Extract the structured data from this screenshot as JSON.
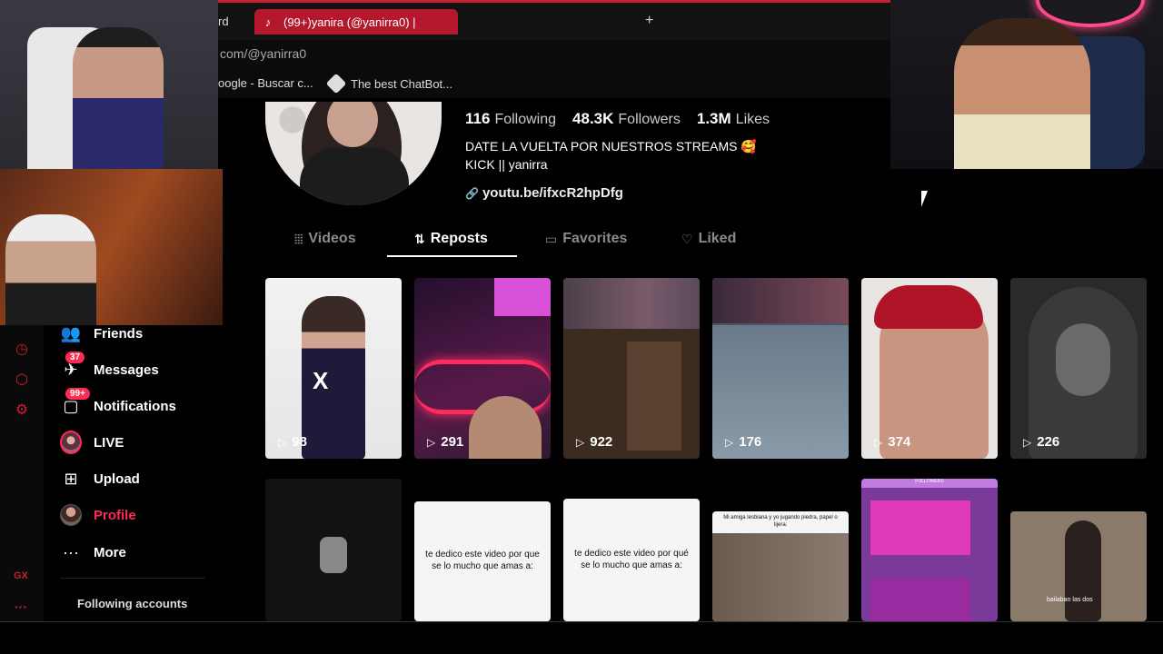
{
  "browser": {
    "prev_tab_fragment": "rd",
    "active_tab": "(99+)yanira (@yanirra0) |",
    "new_tab": "+",
    "url": "com/@yanirra0",
    "bookmarks": [
      "oogle - Buscar c...",
      "The best ChatBot..."
    ]
  },
  "profile": {
    "stats": [
      {
        "value": "116",
        "label": "Following"
      },
      {
        "value": "48.3K",
        "label": "Followers"
      },
      {
        "value": "1.3M",
        "label": "Likes"
      }
    ],
    "bio_line1": "DATE LA VUELTA POR NUESTROS STREAMS 🥰",
    "bio_line2": "KICK || yanirra",
    "link": "youtu.be/ifxcR2hpDfg"
  },
  "tabs": [
    {
      "label": "Videos",
      "icon": "grid-icon"
    },
    {
      "label": "Reposts",
      "icon": "repost-icon",
      "active": true
    },
    {
      "label": "Favorites",
      "icon": "bookmark-icon"
    },
    {
      "label": "Liked",
      "icon": "heart-icon"
    }
  ],
  "grid": {
    "row1_views": [
      "98",
      "291",
      "922",
      "176",
      "374",
      "226"
    ],
    "row2_texts": {
      "c8": "te dedico este video por que se lo mucho que amas a:",
      "c9": "te dedico este video por qué se lo mucho que amas a:",
      "c10": "Mi amiga lesbiana y yo jugando piedra, papel o tijera:",
      "c11": "FOLLOWERS",
      "c12": "bailaban las dos"
    }
  },
  "nav": {
    "items": [
      {
        "label": "Friends",
        "icon": "friends-icon"
      },
      {
        "label": "Messages",
        "icon": "messages-icon",
        "badge": "37"
      },
      {
        "label": "Notifications",
        "icon": "notifications-icon",
        "badge": "99+"
      },
      {
        "label": "LIVE",
        "icon": "live-avatar"
      },
      {
        "label": "Upload",
        "icon": "upload-icon"
      },
      {
        "label": "Profile",
        "icon": "profile-avatar",
        "active": true
      },
      {
        "label": "More",
        "icon": "more-icon"
      }
    ],
    "following_accounts": "Following accounts"
  },
  "gx": {
    "label": "GX",
    "more": "···"
  },
  "colors": {
    "accent": "#fe2c55",
    "gx_red": "#c81e32",
    "profile_active": "#fe2c55"
  }
}
